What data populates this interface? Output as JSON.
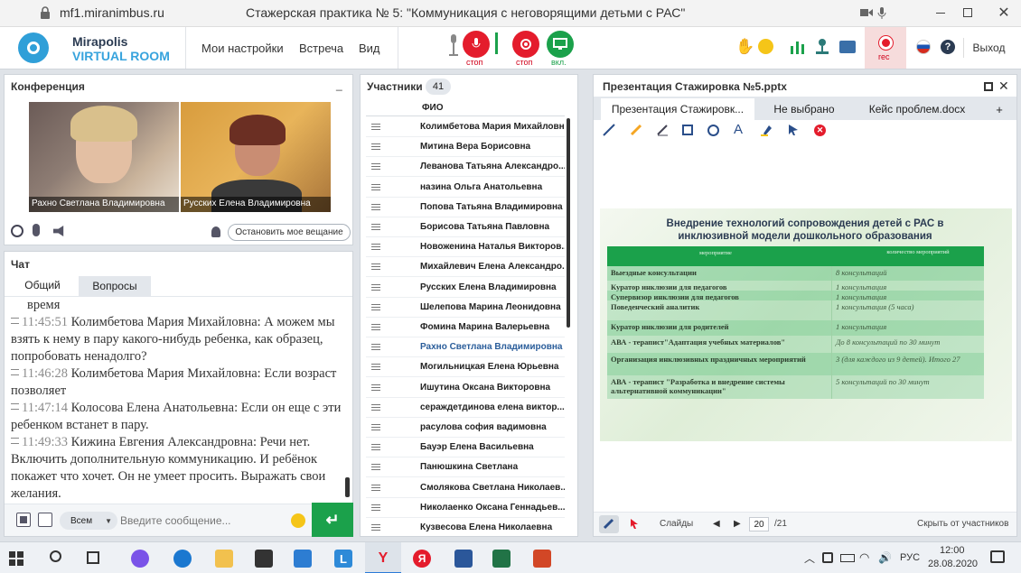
{
  "browser": {
    "url": "mf1.miranimbus.ru",
    "title": "Стажерская практика № 5: \"Коммуникация с неговорящими детьми с РАС\""
  },
  "app": {
    "logo_line1": "Mirapolis",
    "logo_line2": "VIRTUAL ROOM",
    "menu": [
      "Мои настройки",
      "Встреча",
      "Вид"
    ],
    "rec_labels": [
      "стоп",
      "стоп",
      "вкл."
    ],
    "rec_label": "rec",
    "exit_label": "Выход"
  },
  "conference": {
    "title": "Конференция",
    "videos": [
      {
        "name": "Рахно Светлана Владимировна"
      },
      {
        "name": "Русских Елена Владимировна"
      }
    ],
    "stop_broadcast": "Остановить мое вещание"
  },
  "chat": {
    "title": "Чат",
    "tabs": [
      "Общий",
      "Вопросы"
    ],
    "partial_line": "время",
    "messages": [
      {
        "time": "11:45:51",
        "author": "Колимбетова Мария  Михайловна:",
        "text": " А можем мы взять к нему в пару какого-нибудь ребенка, как образец, попробовать ненадолго?"
      },
      {
        "time": "11:46:28",
        "author": "Колимбетова Мария  Михайловна:",
        "text": " Если возраст позволяет"
      },
      {
        "time": "11:47:14",
        "author": "Колосова Елена  Анатольевна:",
        "text": " Если он еще с эти ребенком встанет в пару."
      },
      {
        "time": "11:49:33",
        "author": "Кижина Евгения  Александровна:",
        "text": " Речи нет. Включить дополнительную коммуникацию. И ребёнок покажет что хочет. Он не умеет просить. Выражать свои желания."
      }
    ],
    "recipient": "Всем",
    "input_placeholder": "Введите сообщение..."
  },
  "participants": {
    "title": "Участники",
    "count": "41",
    "column": "ФИО",
    "list": [
      "Колимбетова Мария  Михайловна",
      "Митина Вера  Борисовна",
      "Леванова Татьяна  Александро...",
      "назина  Ольга Анатольевна",
      "Попова Татьяна  Владимировна",
      "Борисова  Татьяна   Павловна",
      "Новоженина Наталья  Викторов...",
      "Михайлевич Елена Александро...",
      "Русских Елена Владимировна",
      "Шелепова  Марина Леонидовна",
      "Фомина Марина  Валерьевна",
      "Рахно Светлана Владимировна",
      "Могильницкая  Елена Юрьевна",
      "Ишутина Оксана Викторовна",
      "сераждетдинова елена  виктор...",
      "расулова софия вадимовна",
      "Бауэр Елена  Васильевна",
      "Панюшкина Светлана",
      "Смолякова Светлана  Николаев...",
      "Николаенко  Оксана  Геннадьев...",
      "Кузвесова Елена  Николаевна"
    ]
  },
  "presentation": {
    "title": "Презентация Стажировка №5.pptx",
    "tabs": [
      "Презентация Стажировк...",
      "Не выбрано",
      "Кейс проблем.docx",
      "+"
    ],
    "slide_title": "Внедрение технологий сопровождения детей с РАС в инклюзивной модели дошкольного образования",
    "table_headers": [
      "мероприятие",
      "количество мероприятий"
    ],
    "table_rows": [
      [
        "Выездные консультации",
        "8 консультаций"
      ],
      [
        "Куратор инклюзии для педагогов",
        "1 консультация"
      ],
      [
        "Супервизор инклюзии для педагогов",
        "1 консультация"
      ],
      [
        "Поведенческий аналитик",
        "1 консультация (5 часа)"
      ],
      [
        "Куратор инклюзии для родителей",
        "1 консультация"
      ],
      [
        "АВА - терапист\"Адаптация учебных материалов\"",
        "До 8 консультаций по 30 минут"
      ],
      [
        "Организация инклюзивных праздничных мероприятий",
        "3 (для каждого из 9 детей). Итого 27"
      ],
      [
        "АВА - терапист \"Разработка и внедрение системы альтернативной коммуникации\"",
        "5 консультаций по 30 минут"
      ]
    ],
    "slides_label": "Слайды",
    "page_current": "20",
    "page_total": "/21",
    "hide_label": "Скрыть от участников"
  },
  "taskbar": {
    "lang": "РУС",
    "time": "12:00",
    "date": "28.08.2020"
  },
  "colors": {
    "accent": "#1ba14b",
    "rec_red": "#d0021b",
    "slide_green": "#42b86a",
    "link_blue": "#2a5d9a"
  }
}
